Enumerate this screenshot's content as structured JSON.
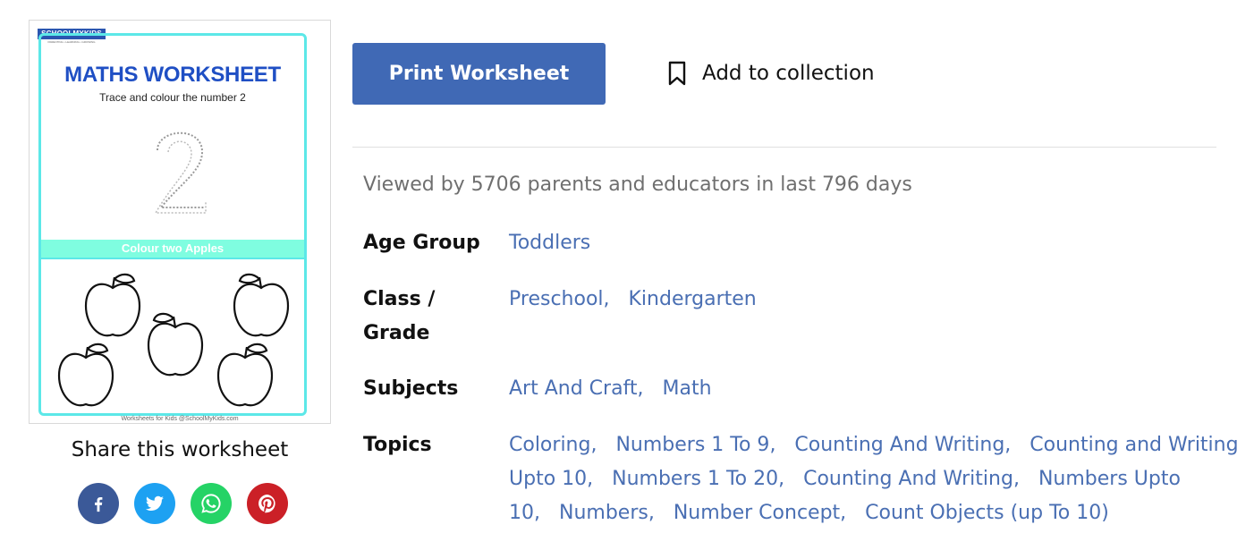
{
  "thumbnail": {
    "logo_text": "SCHOOLMYKIDS",
    "logo_tagline": "PARENTING • LEARNING • GROWING",
    "title": "MATHS WORKSHEET",
    "subtitle": "Trace and colour the number 2",
    "traced_number": "2",
    "band_text": "Colour two Apples",
    "footer": "Worksheets for Kids @SchoolMyKids.com"
  },
  "share": {
    "label": "Share this worksheet",
    "networks": [
      "facebook",
      "twitter",
      "whatsapp",
      "pinterest"
    ]
  },
  "actions": {
    "print_label": "Print Worksheet",
    "collection_label": "Add to collection"
  },
  "stats": {
    "viewed_text": "Viewed by 5706 parents and educators in last 796 days"
  },
  "details": {
    "age_group": {
      "label": "Age Group",
      "values": [
        "Toddlers"
      ]
    },
    "class_grade": {
      "label": "Class / Grade",
      "values": [
        "Preschool",
        "Kindergarten"
      ]
    },
    "subjects": {
      "label": "Subjects",
      "values": [
        "Art And Craft",
        "Math"
      ]
    },
    "topics": {
      "label": "Topics",
      "values": [
        "Coloring",
        "Numbers 1 To 9",
        "Counting And Writing",
        "Counting and Writing Upto 10",
        "Numbers 1 To 20",
        "Counting And Writing",
        "Numbers Upto 10",
        "Numbers",
        "Number Concept",
        "Count Objects (up To 10)"
      ]
    }
  },
  "colors": {
    "primary": "#4069b5",
    "link": "#4a6fb3",
    "facebook": "#3b5998",
    "twitter": "#1da1f2",
    "whatsapp": "#25d366",
    "pinterest": "#cb2027"
  },
  "icons": {
    "bookmark": "bookmark-icon",
    "facebook": "facebook-icon",
    "twitter": "twitter-icon",
    "whatsapp": "whatsapp-icon",
    "pinterest": "pinterest-icon"
  }
}
